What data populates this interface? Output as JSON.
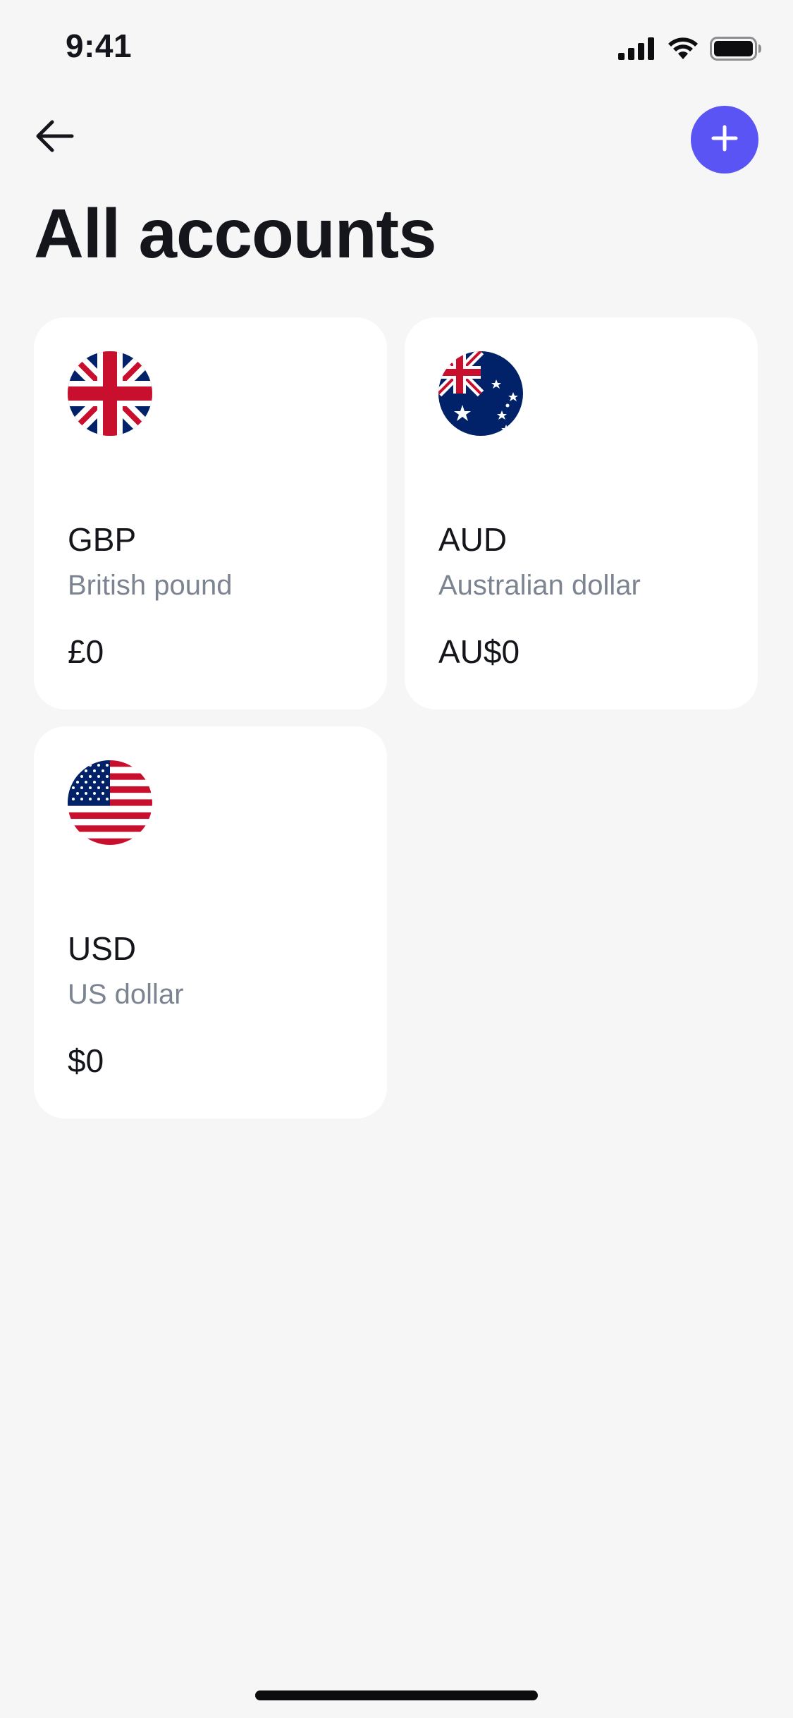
{
  "status_bar": {
    "time": "9:41"
  },
  "header": {
    "title": "All accounts"
  },
  "accounts": [
    {
      "code": "GBP",
      "name": "British pound",
      "balance": "£0"
    },
    {
      "code": "AUD",
      "name": "Australian dollar",
      "balance": "AU$0"
    },
    {
      "code": "USD",
      "name": "US dollar",
      "balance": "$0"
    }
  ],
  "colors": {
    "accent": "#5b54f4",
    "background": "#f6f6f7",
    "card": "#ffffff",
    "secondary_text": "#7c8491"
  },
  "icons": {
    "back": "arrow-left-icon",
    "add": "plus-icon",
    "signal": "signal-icon",
    "wifi": "wifi-icon",
    "battery": "battery-icon"
  }
}
